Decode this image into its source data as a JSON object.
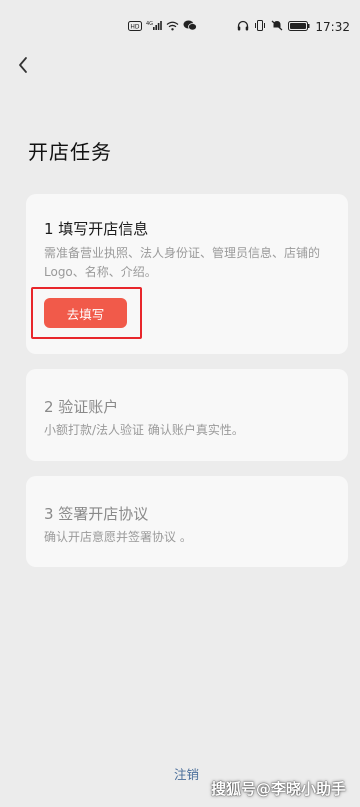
{
  "status_bar": {
    "time": "17:32",
    "network": "4G",
    "left_icons": [
      "hd-icon",
      "signal-icon",
      "wifi-icon",
      "wechat-icon"
    ],
    "right_icons": [
      "headphones-icon",
      "vibrate-icon",
      "mute-icon",
      "battery-icon"
    ]
  },
  "header": {
    "back_icon": "chevron-left-icon"
  },
  "page": {
    "title": "开店任务"
  },
  "tasks": [
    {
      "title": "1 填写开店信息",
      "description": "需准备营业执照、法人身份证、管理员信息、店铺的Logo、名称、介绍。",
      "button": "去填写",
      "active": true
    },
    {
      "title": "2 验证账户",
      "description": "小额打款/法人验证 确认账户真实性。",
      "active": false
    },
    {
      "title": "3 签署开店协议",
      "description": "确认开店意愿并签署协议 。",
      "active": false
    }
  ],
  "footer": {
    "cancel_label": "注销"
  },
  "watermark": "搜狐号@李晓小助手",
  "colors": {
    "primary_button": "#f15a4a",
    "highlight_border": "#e8262b",
    "link": "#4a6e9a",
    "background": "#ececec",
    "card": "#f8f8f8"
  }
}
